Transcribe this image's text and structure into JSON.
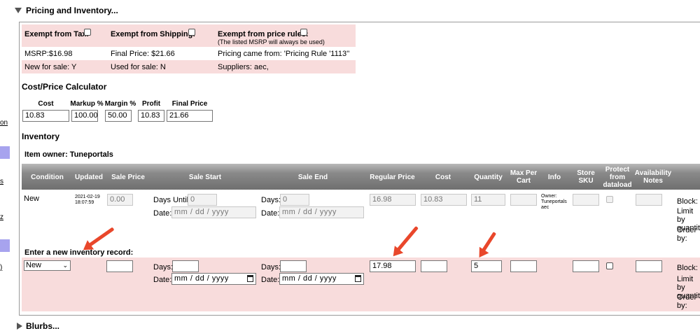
{
  "sections": {
    "pricing_title": "Pricing and Inventory...",
    "blurbs_title": "Blurbs..."
  },
  "sidebar_fragments": [
    "on",
    "s",
    "z",
    ")"
  ],
  "pricing": {
    "exempt_tax": "Exempt from Tax:",
    "exempt_shipping": "Exempt from Shipping:",
    "exempt_rules": "Exempt from price rules:",
    "exempt_rules_note": "(The listed MSRP will always be used)",
    "msrp": "MSRP:$16.98",
    "final_price": "Final Price: $21.66",
    "pricing_came_from": "Pricing came from: 'Pricing Rule '1113''",
    "new_for_sale": "New for sale: Y",
    "used_for_sale": "Used for sale: N",
    "suppliers": "Suppliers: aec,"
  },
  "calculator": {
    "title": "Cost/Price Calculator",
    "headers": [
      "Cost",
      "Markup %",
      "Margin %",
      "Profit",
      "Final Price"
    ],
    "values": [
      "10.83",
      "100.00",
      "50.00",
      "10.83",
      "21.66"
    ]
  },
  "inventory": {
    "title": "Inventory",
    "owner": "Item owner: Tuneportals",
    "headers": {
      "condition": "Condition",
      "updated": "Updated",
      "sale_price": "Sale Price",
      "sale_start": "Sale Start",
      "sale_end": "Sale End",
      "regular_price": "Regular Price",
      "cost": "Cost",
      "quantity": "Quantity",
      "max_per_cart": "Max Per Cart",
      "info": "Info",
      "store_sku": "Store SKU",
      "protect": "Protect from dataload",
      "availability": "Availability Notes"
    },
    "row": {
      "condition": "New",
      "updated": "2021-02-19 18:07:59",
      "sale_price": "0.00",
      "days_until_label": "Days Until:",
      "days_until": "0",
      "date_label": "Date:",
      "date_placeholder": "mm / dd / yyyy",
      "days_label": "Days:",
      "days_end": "0",
      "regular_price": "16.98",
      "cost": "10.83",
      "quantity": "11",
      "info": "Owner: Tuneportals aec",
      "block": "Block:",
      "limit": "Limit by quantity",
      "order": "Order by:"
    },
    "new_record": {
      "label": "Enter a new inventory record:",
      "condition": "New",
      "regular_price": "17.98",
      "quantity": "5",
      "days_label": "Days:",
      "date_label": "Date:",
      "date_placeholder": "mm / dd / yyyy",
      "block": "Block:",
      "limit": "Limit by quantity",
      "order": "Order by:"
    }
  },
  "colors": {
    "pink": "#f8dcdc",
    "arrow": "#e9472b",
    "sidebar_accent": "#a7a3ee"
  }
}
